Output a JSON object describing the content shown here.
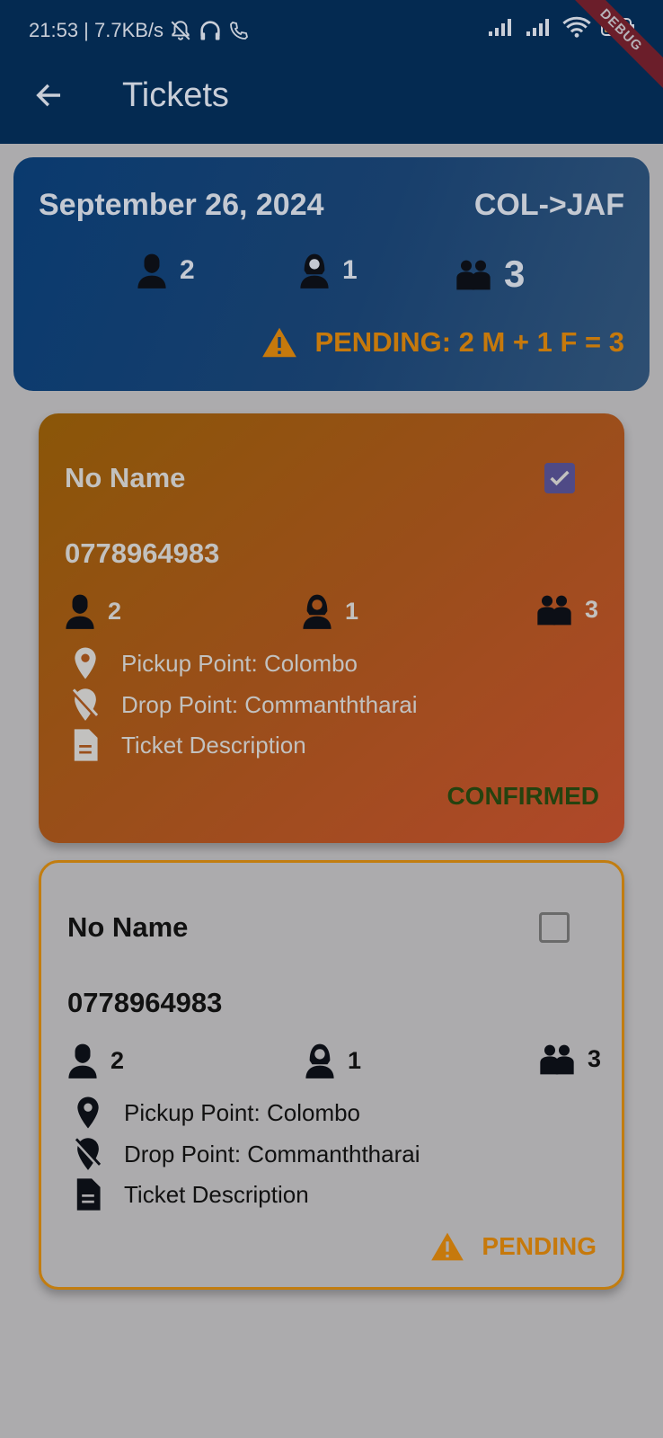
{
  "status_bar": {
    "time_speed": "21:53 | 7.7KB/s",
    "debug_label": "DEBUG"
  },
  "header": {
    "title": "Tickets"
  },
  "summary": {
    "date": "September 26, 2024",
    "route": "COL->JAF",
    "male_count": "2",
    "female_count": "1",
    "total_count": "3",
    "pending_text": "PENDING: 2 M + 1 F = 3"
  },
  "tickets": [
    {
      "name": "No Name",
      "phone": "0778964983",
      "male": "2",
      "female": "1",
      "total": "3",
      "pickup": "Pickup Point: Colombo",
      "drop": "Drop Point: Commanththarai",
      "description": "Ticket Description",
      "status": "CONFIRMED",
      "checked": true
    },
    {
      "name": "No Name",
      "phone": "0778964983",
      "male": "2",
      "female": "1",
      "total": "3",
      "pickup": "Pickup Point: Colombo",
      "drop": "Drop Point: Commanththarai",
      "description": "Ticket Description",
      "status": "PENDING",
      "checked": false
    }
  ],
  "colors": {
    "appbar": "#042a51",
    "pending_accent": "#c6790c",
    "confirmed_text": "#25420f",
    "checkbox_checked": "#4f4a86"
  }
}
